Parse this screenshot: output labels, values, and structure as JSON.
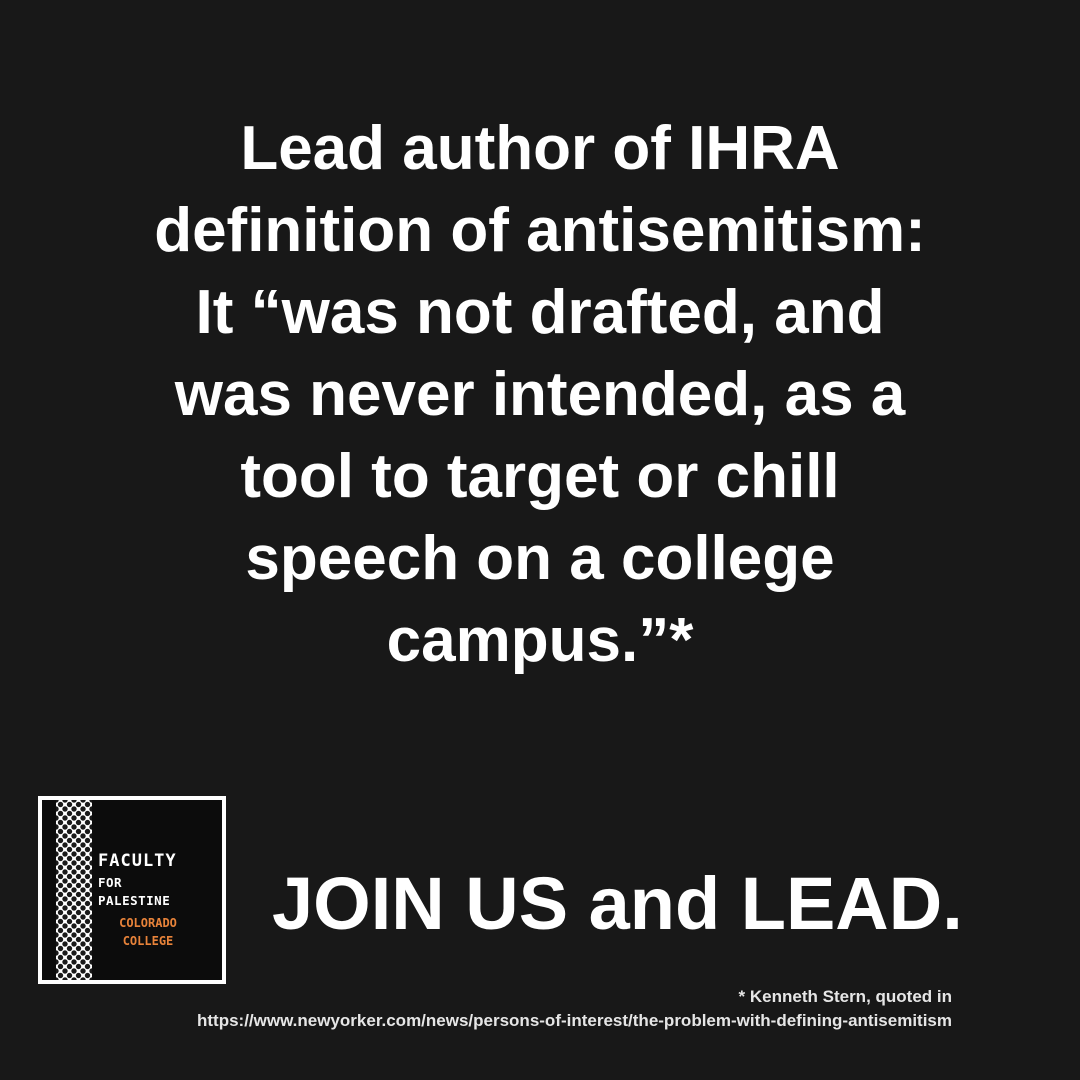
{
  "quote": {
    "lines": [
      "Lead author of IHRA",
      "definition of antisemitism:",
      "It “was not drafted, and",
      "was never intended, as a",
      "tool to target or chill",
      "speech on a college",
      "campus.”*"
    ]
  },
  "logo": {
    "line1": "FACULTY",
    "line2": "FOR",
    "line3": "PALESTINE",
    "line4": "COLORADO",
    "line5": "COLLEGE",
    "accent_color": "#e8833a"
  },
  "cta": {
    "text": "JOIN US and LEAD."
  },
  "footnote": {
    "line1": "* Kenneth Stern, quoted in",
    "line2": "https://www.newyorker.com/news/persons-of-interest/the-problem-with-defining-antisemitism"
  },
  "colors": {
    "background": "#181818",
    "text": "#ffffff"
  }
}
